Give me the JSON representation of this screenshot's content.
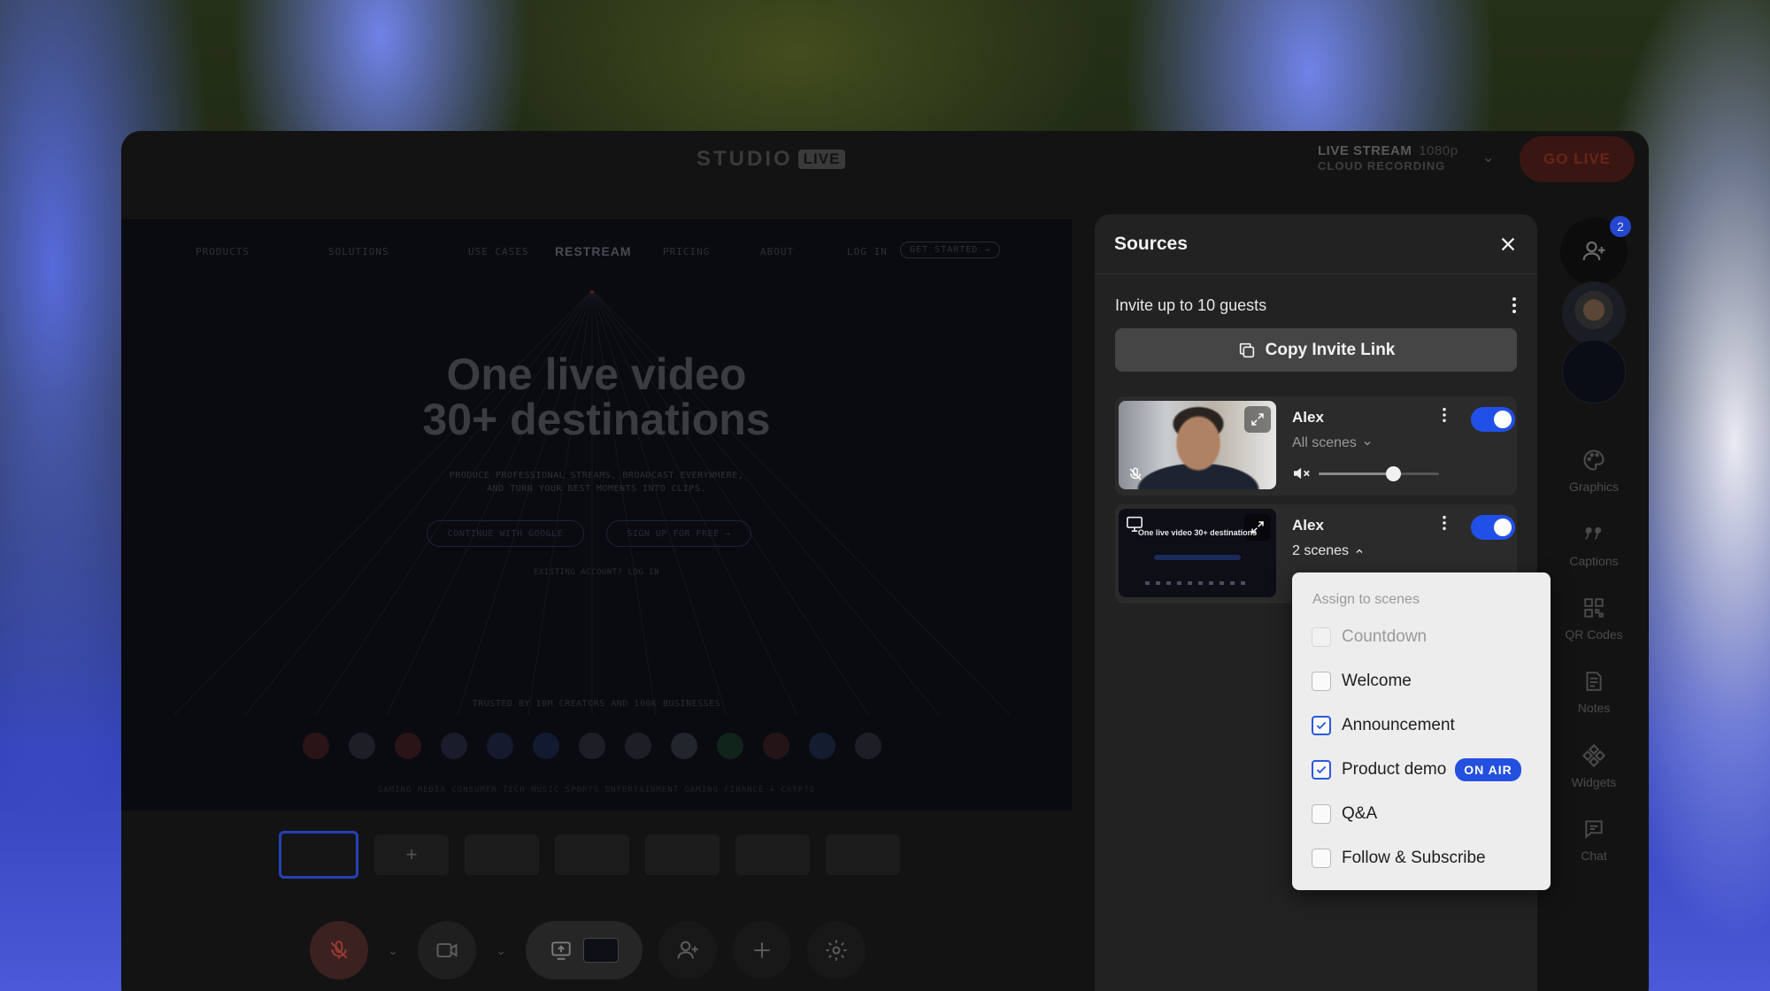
{
  "app": {
    "brand": "STUDIO",
    "brand_badge": "LIVE",
    "stream_title": "LIVE STREAM",
    "stream_quality": "1080p",
    "stream_subtitle": "CLOUD RECORDING",
    "go_live_label": "GO LIVE"
  },
  "stage": {
    "nav": [
      "PRODUCTS",
      "SOLUTIONS",
      "USE CASES",
      "RESTREAM",
      "PRICING",
      "ABOUT",
      "LOG IN",
      "GET STARTED →"
    ],
    "title_line1": "One live video",
    "title_line2": "30+ destinations",
    "subtitle_line1": "PRODUCE PROFESSIONAL STREAMS, BROADCAST EVERYWHERE,",
    "subtitle_line2": "AND TURN YOUR BEST MOMENTS INTO CLIPS.",
    "btn_google": "CONTINUE WITH GOOGLE",
    "btn_signup": "SIGN UP FOR FREE →",
    "existing_account": "EXISTING ACCOUNT? LOG IN",
    "trusted": "TRUSTED BY 10M CREATORS AND 100K BUSINESSES",
    "categories": "GAMING   MEDIA   CONSUMER TECH   MUSIC   SPORTS   ENTERTAINMENT   GAMING   FINANCE + CRYPTO"
  },
  "rail": {
    "guest_badge": "2",
    "items": [
      "Graphics",
      "Captions",
      "QR Codes",
      "Notes",
      "Widgets",
      "Chat"
    ]
  },
  "sources": {
    "title": "Sources",
    "invite_text": "Invite up to 10 guests",
    "copy_label": "Copy Invite Link",
    "items": [
      {
        "name": "Alex",
        "scenes": "All scenes",
        "volume": 0.62,
        "enabled": true
      },
      {
        "name": "Alex",
        "scenes": "2 scenes",
        "enabled": true,
        "thumb_title": "One live video 30+ destinations"
      }
    ]
  },
  "assign": {
    "header": "Assign to scenes",
    "scenes": [
      {
        "label": "Countdown",
        "checked": false,
        "disabled": true
      },
      {
        "label": "Welcome",
        "checked": false
      },
      {
        "label": "Announcement",
        "checked": true
      },
      {
        "label": "Product demo",
        "checked": true,
        "badge": "ON AIR"
      },
      {
        "label": "Q&A",
        "checked": false
      },
      {
        "label": "Follow & Subscribe",
        "checked": false
      }
    ]
  },
  "colors": {
    "accent": "#2150e8",
    "on_air": "#2450e0",
    "go_live": "#3a1612"
  }
}
